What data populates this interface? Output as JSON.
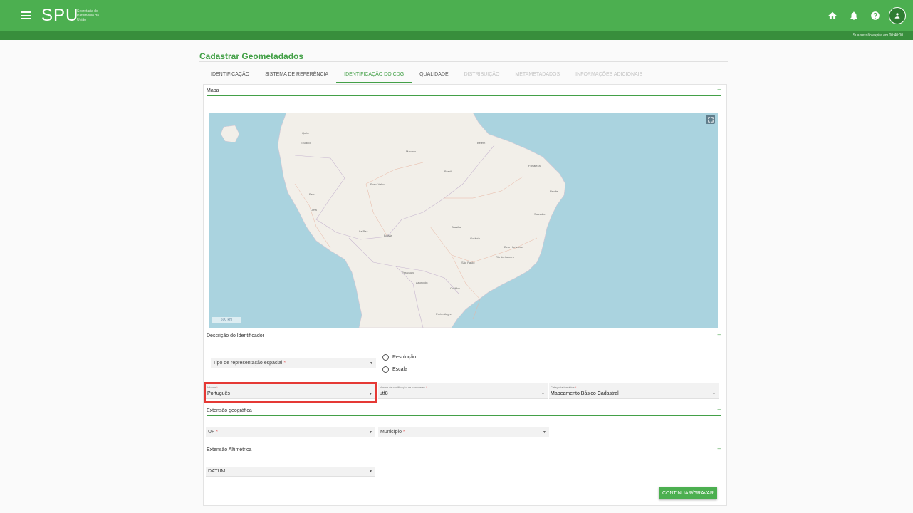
{
  "header": {
    "logo": "SPU",
    "logo_sub": "Secretaria do Patrimônio da União",
    "session": "Sua sessão expira em 00:40:00",
    "icons": [
      "home-icon",
      "bell-icon",
      "help-icon",
      "user-icon"
    ]
  },
  "page": {
    "title": "Cadastrar Geometadados"
  },
  "tabs": [
    {
      "label": "IDENTIFICAÇÃO",
      "state": "normal"
    },
    {
      "label": "SISTEMA DE REFERÊNCIA",
      "state": "normal"
    },
    {
      "label": "IDENTIFICAÇÃO DO CDG",
      "state": "active"
    },
    {
      "label": "QUALIDADE",
      "state": "normal"
    },
    {
      "label": "DISTRIBUIÇÃO",
      "state": "disabled"
    },
    {
      "label": "METAMETADADOS",
      "state": "disabled"
    },
    {
      "label": "INFORMAÇÕES ADICIONAIS",
      "state": "disabled"
    }
  ],
  "sections": {
    "mapa": "Mapa",
    "descricao": "Descrição do Identificador",
    "extensao_geo": "Extensão geográfica",
    "extensao_alt": "Extensão Altimétrica",
    "toggle": "–"
  },
  "map": {
    "scale": "500 km",
    "labels": {
      "quito": "Quito",
      "ecuador": "Ecuador",
      "peru": "Peru",
      "lima": "Lima",
      "manaus": "Manaus",
      "belem": "Belém",
      "brasil": "Brasil",
      "bolivia": "Bolivia",
      "la_paz": "La Paz",
      "brasilia": "Brasília",
      "sao_paulo": "São Paulo",
      "rio": "Rio de Janeiro",
      "salvador": "Salvador",
      "recife": "Recife",
      "fortaleza": "Fortaleza",
      "paraguay": "Paraguay",
      "asuncion": "Asunción",
      "porto_velho": "Porto Velho",
      "goiania": "Goiânia",
      "belo_horizonte": "Belo Horizonte",
      "curitiba": "Curitiba",
      "porto_alegre": "Porto Alegre"
    }
  },
  "form": {
    "tipo_representacao": {
      "placeholder": "Tipo de representação espacial",
      "req": " *"
    },
    "radio_resolucao": "Resolução",
    "radio_escala": "Escala",
    "idioma": {
      "label": "Idioma",
      "req": " *",
      "value": "Português"
    },
    "norma": {
      "label": "Norma de codificação de caracteres",
      "req": " *",
      "value": "utf8"
    },
    "categoria": {
      "label": "Categoria temática",
      "req": " *",
      "value": "Mapeamento Básico Cadastral"
    },
    "uf": {
      "placeholder": "UF",
      "req": " *"
    },
    "municipio": {
      "placeholder": "Município",
      "req": " *"
    },
    "datum": {
      "placeholder": "DATUM"
    },
    "caret": "▼"
  },
  "actions": {
    "continue": "CONTINUAR/GRAVAR"
  },
  "colors": {
    "primary": "#4caf50",
    "primary_dark": "#388e3c",
    "ocean": "#aad3df",
    "highlight": "#e53935"
  }
}
